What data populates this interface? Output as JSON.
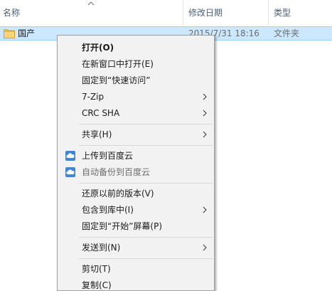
{
  "header": {
    "name_col": "名称",
    "date_col": "修改日期",
    "type_col": "类型"
  },
  "file": {
    "name": "国产",
    "date": "2015/7/31 18:16",
    "type": "文件夹"
  },
  "menu": {
    "open": "打开(O)",
    "open_new_window": "在新窗口中打开(E)",
    "pin_quick_access": "固定到“快速访问”",
    "zip": "7-Zip",
    "crc": "CRC SHA",
    "share": "共享(H)",
    "upload_baidu": "上传到百度云",
    "auto_backup_baidu": "自动备份到百度云",
    "restore_versions": "还原以前的版本(V)",
    "include_library": "包含到库中(I)",
    "pin_start": "固定到“开始”屏幕(P)",
    "send_to": "发送到(N)",
    "cut": "剪切(T)",
    "copy": "复制(C)"
  },
  "colors": {
    "selection_bg": "#cce8ff",
    "selection_border": "#99d1ff",
    "menu_bg": "#f2f2f2",
    "header_text": "#4c607a",
    "cloud_icon": "#3d86d8"
  }
}
